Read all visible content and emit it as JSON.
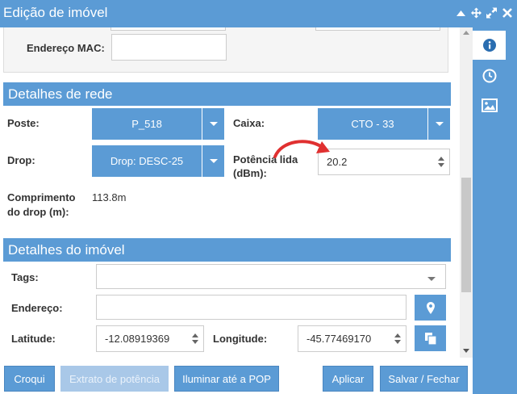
{
  "window": {
    "title": "Edição de imóvel",
    "colors": {
      "accent": "#5b9bd5",
      "annotation_arrow": "#e03030"
    }
  },
  "top_section": {
    "mac_label": "Endereço MAC:",
    "mac_value": ""
  },
  "network": {
    "header": "Detalhes de rede",
    "poste_label": "Poste:",
    "poste_value": "P_518",
    "caixa_label": "Caixa:",
    "caixa_value": "CTO - 33",
    "drop_label": "Drop:",
    "drop_value": "Drop: DESC-25",
    "potencia_label_line1": "Potência lida",
    "potencia_label_line2": "(dBm):",
    "potencia_value": "20.2",
    "comprimento_label_line1": "Comprimento",
    "comprimento_label_line2": "do drop (m):",
    "comprimento_value": "113.8m"
  },
  "property": {
    "header": "Detalhes do imóvel",
    "tags_label": "Tags:",
    "tags_value": "",
    "endereco_label": "Endereço:",
    "endereco_value": "",
    "latitude_label": "Latitude:",
    "latitude_value": "-12.08919369",
    "longitude_label": "Longitude:",
    "longitude_value": "-45.77469170"
  },
  "footer": {
    "croqui": "Croqui",
    "extrato": "Extrato de potência",
    "iluminar": "Iluminar até a POP",
    "aplicar": "Aplicar",
    "salvar": "Salvar / Fechar"
  },
  "side_tabs": [
    {
      "icon": "info-icon",
      "active": true
    },
    {
      "icon": "clock-icon",
      "active": false
    },
    {
      "icon": "image-icon",
      "active": false
    }
  ]
}
